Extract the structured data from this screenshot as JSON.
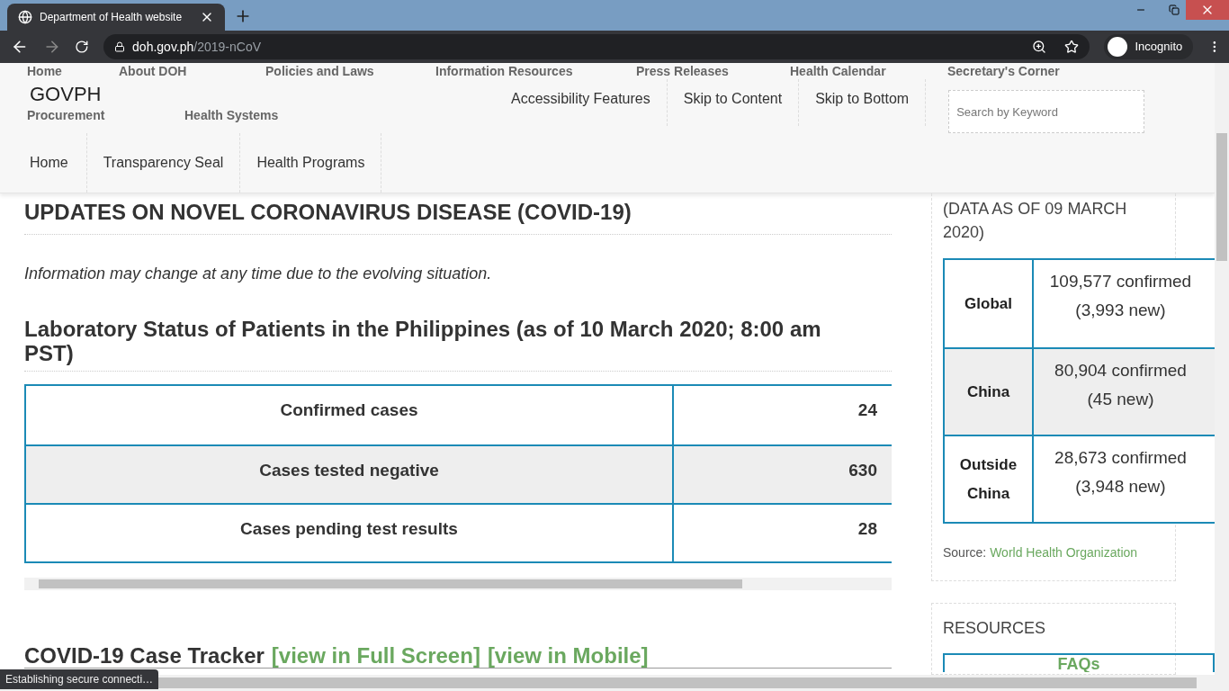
{
  "browser": {
    "tab_title": "Department of Health website",
    "url_host": "doh.gov.ph",
    "url_path": "/2019-nCoV",
    "profile": "Incognito",
    "status": "Establishing secure connecti…"
  },
  "header": {
    "top_nav": [
      "Home",
      "About DOH",
      "Policies and Laws",
      "Information Resources",
      "Press Releases",
      "Health Calendar",
      "Secretary's Corner"
    ],
    "logo": "GOVPH",
    "second_nav": [
      "Procurement",
      "Health Systems"
    ],
    "utility_links": [
      "Accessibility Features",
      "Skip to Content",
      "Skip to Bottom"
    ],
    "search": {
      "placeholder": "Search by Keyword"
    },
    "main_nav": [
      "Home",
      "Transparency Seal",
      "Health Programs"
    ]
  },
  "main": {
    "title": "UPDATES ON NOVEL CORONAVIRUS DISEASE (COVID-19)",
    "note": "Information may change at any time due to the evolving situation.",
    "lab_heading": "Laboratory Status of Patients in the Philippines (as of 10 March 2020; 8:00 am PST)",
    "lab_table": [
      {
        "label": "Confirmed cases",
        "value": "24"
      },
      {
        "label": "Cases tested negative",
        "value": "630"
      },
      {
        "label": "Cases pending test results",
        "value": "28"
      }
    ],
    "tracker": {
      "title": "COVID-19 Case Tracker",
      "links": [
        "[view in Full Screen]",
        "[view in Mobile]"
      ]
    }
  },
  "sidebar": {
    "data_note": "(DATA AS OF 09 MARCH 2020)",
    "rows": [
      {
        "region": "Global",
        "confirmed": "109,577 confirmed",
        "new": "(3,993 new)"
      },
      {
        "region": "China",
        "confirmed": "80,904 confirmed",
        "new": "(45 new)"
      },
      {
        "region": "Outside China",
        "confirmed": "28,673 confirmed",
        "new": "(3,948 new)"
      }
    ],
    "source_label": "Source:",
    "source_link": "World Health Organization",
    "resources_title": "RESOURCES",
    "resources": [
      "FAQs"
    ]
  }
}
